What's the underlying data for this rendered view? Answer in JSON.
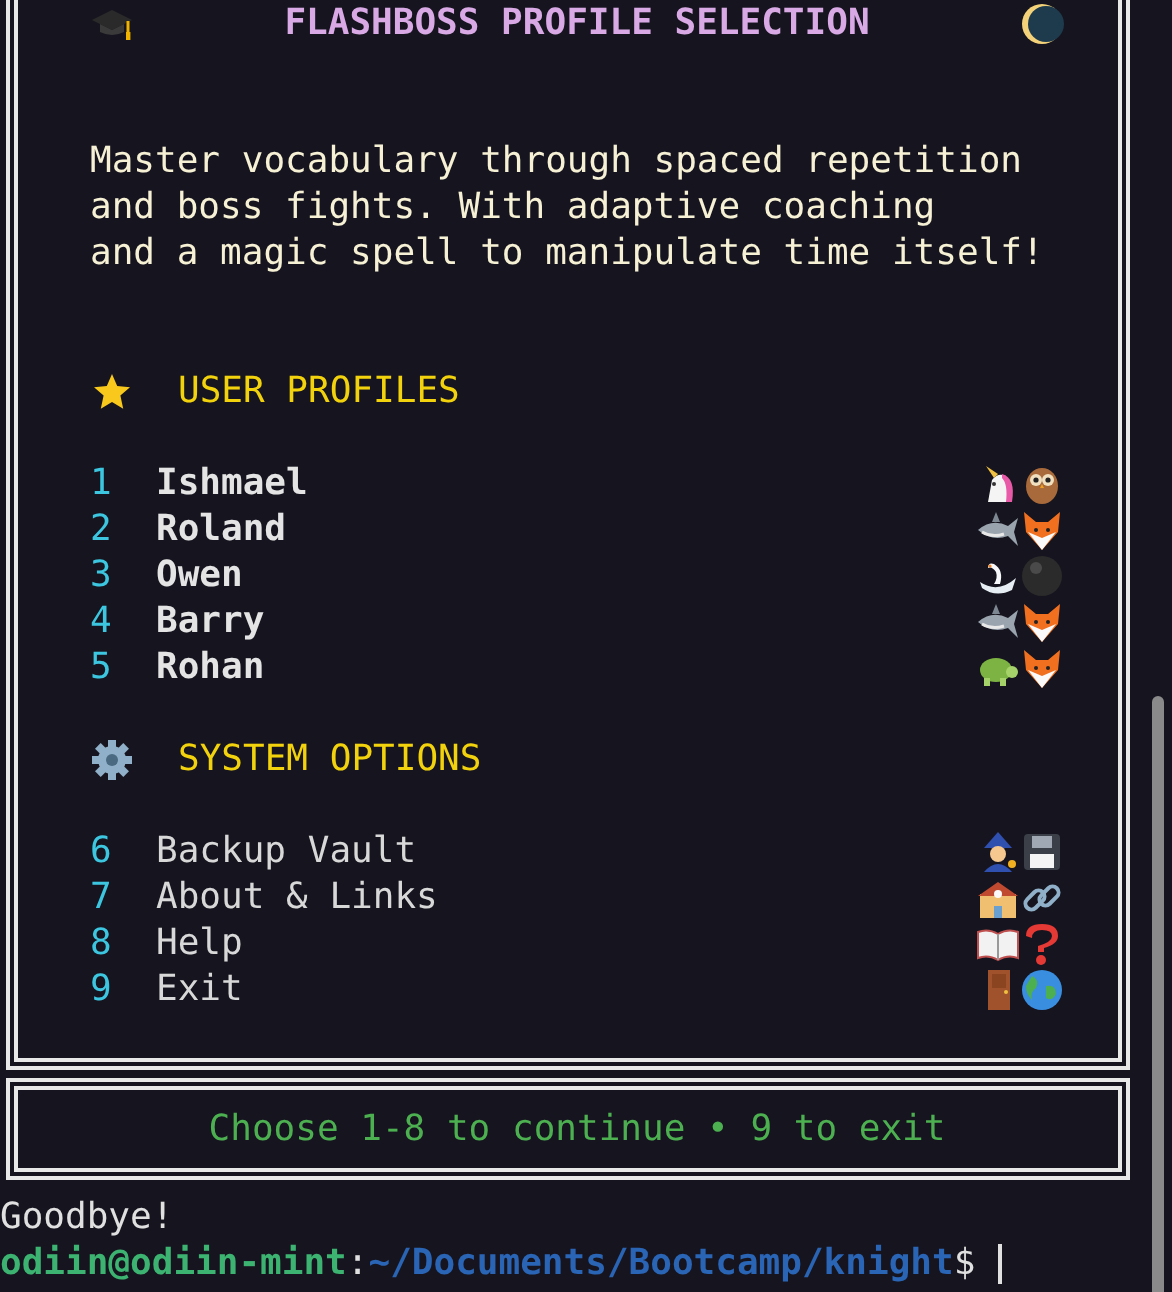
{
  "header": {
    "title": "FLASHBOSS PROFILE SELECTION"
  },
  "description": [
    "Master vocabulary through spaced repetition",
    "and boss fights. With adaptive coaching",
    "and a magic spell to manipulate time itself!"
  ],
  "sections": [
    {
      "kind": "profiles",
      "title": "USER PROFILES",
      "items": [
        {
          "number": "1",
          "label": "Ishmael"
        },
        {
          "number": "2",
          "label": "Roland"
        },
        {
          "number": "3",
          "label": "Owen"
        },
        {
          "number": "4",
          "label": "Barry"
        },
        {
          "number": "5",
          "label": "Rohan"
        }
      ]
    },
    {
      "kind": "options",
      "title": "SYSTEM OPTIONS",
      "items": [
        {
          "number": "6",
          "label": "Backup Vault"
        },
        {
          "number": "7",
          "label": "About & Links"
        },
        {
          "number": "8",
          "label": "Help"
        },
        {
          "number": "9",
          "label": "Exit"
        }
      ]
    }
  ],
  "footer": "Choose 1-8 to continue • 9 to exit",
  "terminal": {
    "output": "Goodbye!",
    "prompt": {
      "user_host": "odiin@odiin-mint",
      "separator": ":",
      "path": "~/Documents/Bootcamp/knight",
      "symbol": "$"
    }
  }
}
